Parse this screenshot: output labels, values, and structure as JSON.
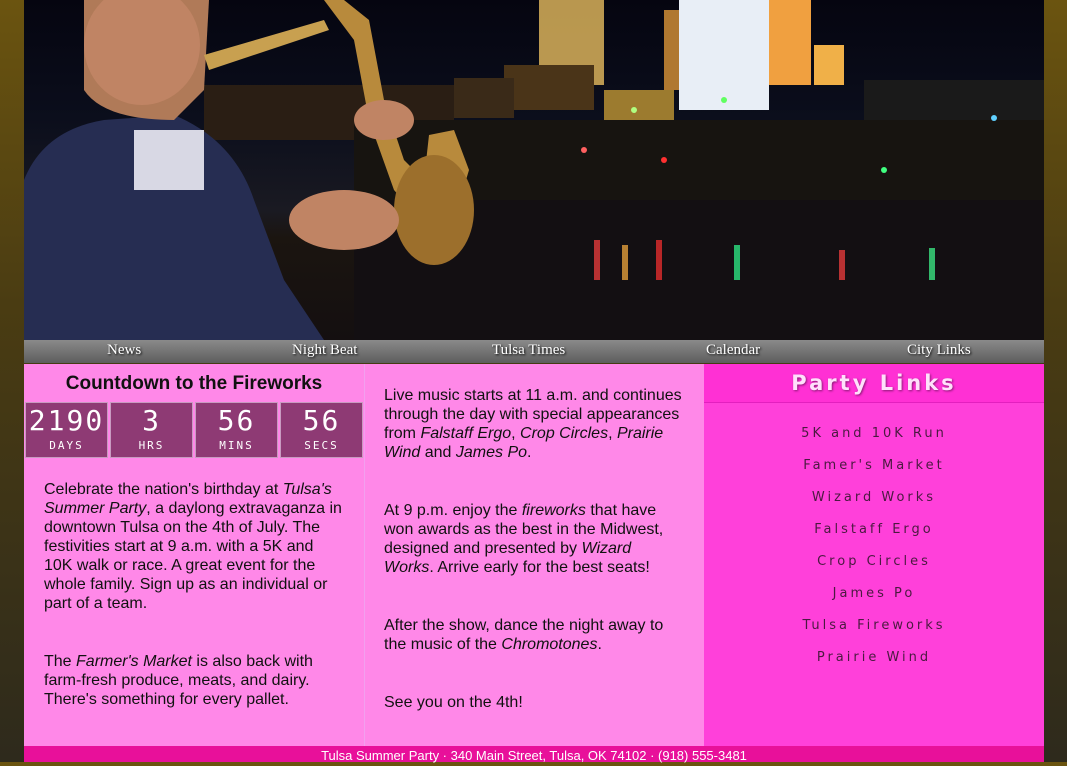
{
  "nav": {
    "items": [
      "News",
      "Night Beat",
      "Tulsa Times",
      "Calendar",
      "City Links"
    ]
  },
  "countdown": {
    "title": "Countdown to the Fireworks",
    "days": {
      "value": "2190",
      "label": "DAYS"
    },
    "hours": {
      "value": "3",
      "label": "HRS"
    },
    "mins": {
      "value": "56",
      "label": "MINS"
    },
    "secs": {
      "value": "56",
      "label": "SECS"
    }
  },
  "column1": {
    "p1": {
      "a": "Celebrate the nation's birthday at ",
      "b": "Tulsa's Summer Party",
      "c": ", a daylong extravaganza in downtown Tulsa on the 4th of July. The festivities start at 9 a.m. with a 5K and 10K walk or race. A great event for the whole family. Sign up as an individual or part of a team."
    },
    "p2": {
      "a": "The ",
      "b": "Farmer's Market",
      "c": " is also back with farm-fresh produce, meats, and dairy. There's something for every pallet."
    }
  },
  "column2": {
    "p1": {
      "a": "Live music starts at 11 a.m. and continues through the day with special appearances from ",
      "b": "Falstaff Ergo",
      "c": ", ",
      "d": "Crop Circles",
      "e": ", ",
      "f": "Prairie Wind",
      "g": " and ",
      "h": "James Po",
      "i": "."
    },
    "p2": {
      "a": "At 9 p.m. enjoy the ",
      "b": "fireworks",
      "c": " that have won awards as the best in the Midwest, designed and presented by ",
      "d": "Wizard Works",
      "e": ". Arrive early for the best seats!"
    },
    "p3": {
      "a": "After the show, dance the night away to the music of the ",
      "b": "Chromotones",
      "c": "."
    },
    "p4": "See you on the 4th!"
  },
  "party_links": {
    "title": "Party Links",
    "items": [
      "5K and 10K Run",
      "Famer's Market",
      "Wizard Works",
      "Falstaff Ergo",
      "Crop Circles",
      "James Po",
      "Tulsa Fireworks",
      "Prairie Wind"
    ]
  },
  "footer": {
    "text": "Tulsa Summer Party · 340 Main Street, Tulsa, OK 74102 · (918) 555-3481"
  },
  "colors": {
    "content_pink": "#ff88e8",
    "links_magenta": "#ff40da",
    "footer_pink": "#e8109a",
    "countdown_cell": "#8e3a74"
  }
}
